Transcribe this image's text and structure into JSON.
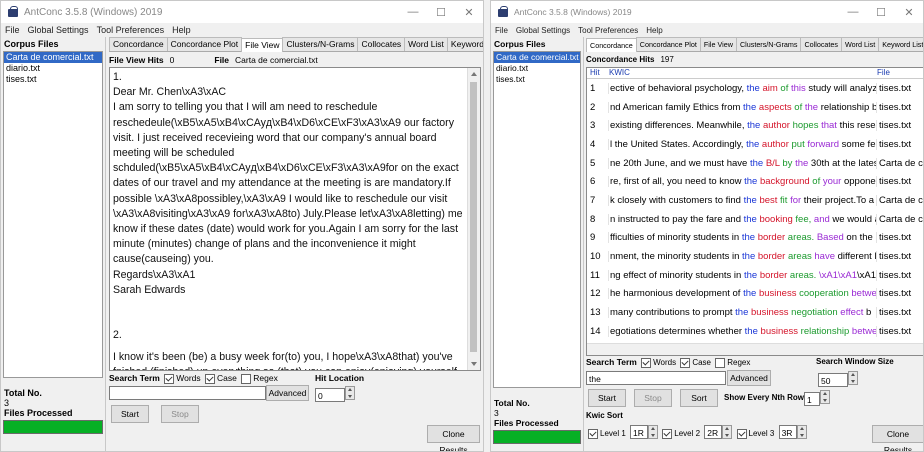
{
  "left_window": {
    "title": "AntConc 3.5.8 (Windows) 2019",
    "menu": [
      "File",
      "Global Settings",
      "Tool Preferences",
      "Help"
    ],
    "corpus_files_label": "Corpus Files",
    "files": [
      "Carta de comercial.txt",
      "diario.txt",
      "tises.txt"
    ],
    "total_no_label": "Total No.",
    "total_no": "3",
    "files_processed_label": "Files Processed",
    "tabs": [
      "Concordance",
      "Concordance Plot",
      "File View",
      "Clusters/N-Grams",
      "Collocates",
      "Word List",
      "Keyword List"
    ],
    "active_tab": "File View",
    "hits_label": "File View Hits",
    "hits_value": "0",
    "file_label": "File",
    "file_value": "Carta de comercial.txt",
    "text_lines": [
      "1.",
      "Dear Mr. Chen\\xA3\\xAC",
      "I am sorry to telling you that I will am need to reschedule reschedeule(\\xB5\\xA5\\xB4\\xCAyд\\xB4\\xD6\\xCE\\xF3\\xA3\\xA9 our factory visit. I just received receviei­ng word that our company's annual board meeting will be scheduled schduled(\\xB5\\xA5\\xB4\\xCAyд\\xB4\\xD6\\xCE\\xF3\\xA3\\xA9for on the exact dates of our travel and my attendance at the meeting is are mandatory.If possible \\xA3\\xA8possibley,\\xA3\\xA9 I would like to reschedule our visit \\xA3\\xA8visiting\\xA3\\xA9 for\\xA3\\xA8to) July.Please let\\xA3\\xA8letting) me know if these dates (date) would work for you.Again I am sorry for the last minute (minutes) change of plans and the inconvenience it might cause(causeing) you.",
      "Regards\\xA3\\xA1",
      "Sarah Edwards",
      "2.",
      "I know it's been (be) a busy week for(to) you, I hope\\xA3\\xA8that) you've fnished (finished) up everything so (that) you can enjoy(enjoying) yourself this weekend.The"
    ],
    "search_term_label": "Search Term",
    "words_label": "Words",
    "case_label": "Case",
    "regex_label": "Regex",
    "hit_location_label": "Hit Location",
    "hit_location_value": "0",
    "advanced_label": "Advanced",
    "start_label": "Start",
    "stop_label": "Stop",
    "clone_label": "Clone Results"
  },
  "right_window": {
    "title": "AntConc 3.5.8 (Windows) 2019",
    "menu": [
      "File",
      "Global Settings",
      "Tool Preferences",
      "Help"
    ],
    "corpus_files_label": "Corpus Files",
    "files": [
      "Carta de comercial.txt",
      "diario.txt",
      "tises.txt"
    ],
    "total_no_label": "Total No.",
    "total_no": "3",
    "files_processed_label": "Files Processed",
    "tabs": [
      "Concordance",
      "Concordance Plot",
      "File View",
      "Clusters/N-Grams",
      "Collocates",
      "Word List",
      "Keyword List"
    ],
    "active_tab": "Concordance",
    "hits_label": "Concordance Hits",
    "hits_value": "197",
    "col_hit": "Hit",
    "col_kwic": "KWIC",
    "col_file": "File",
    "rows": [
      {
        "hit": "1",
        "left": "ective of behavioral psychology, ",
        "kw": "the",
        "r1": "aim",
        "r2": "of",
        "r3": "this",
        "rest": " study will analyze",
        "file": "tises.txt"
      },
      {
        "hit": "2",
        "left": "nd American family Ethics from ",
        "kw": "the",
        "r1": "aspects",
        "r2": "of",
        "r3": "the",
        "rest": " relationship b",
        "file": "tises.txt"
      },
      {
        "hit": "3",
        "left": "existing differences. Meanwhile, ",
        "kw": "the",
        "r1": "author",
        "r2": "hopes",
        "r3": "that",
        "rest": " this resea",
        "file": "tises.txt"
      },
      {
        "hit": "4",
        "left": "l the United States. Accordingly, ",
        "kw": "the",
        "r1": "author",
        "r2": "put",
        "r3": "forward",
        "rest": " some fe",
        "file": "tises.txt"
      },
      {
        "hit": "5",
        "left": "ne 20th June, and we must have ",
        "kw": "the",
        "r1": "B/L",
        "r2": "by",
        "r3": "the",
        "rest": " 30th at the latest.",
        "file": "Carta de con"
      },
      {
        "hit": "6",
        "left": "re, first of all, you need to know ",
        "kw": "the",
        "r1": "background",
        "r2": "of",
        "r3": "your",
        "rest": " oppone",
        "file": "tises.txt"
      },
      {
        "hit": "7",
        "left": "k closely with customers to find ",
        "kw": "the",
        "r1": "best",
        "r2": "fit",
        "r3": "for",
        "rest": " their project.To a",
        "file": "Carta de con"
      },
      {
        "hit": "8",
        "left": "n instructed to pay the fare and ",
        "kw": "the",
        "r1": "booking",
        "r2": "fee,",
        "r3": "and",
        "rest": " we would a",
        "file": "Carta de con"
      },
      {
        "hit": "9",
        "left": "fficulties of minority students in ",
        "kw": "the",
        "r1": "border",
        "r2": "areas.",
        "r3": "Based",
        "rest": " on the S",
        "file": "tises.txt"
      },
      {
        "hit": "10",
        "left": "nment, the minority students in ",
        "kw": "the",
        "r1": "border",
        "r2": "areas",
        "r3": "have",
        "rest": " different l",
        "file": "tises.txt"
      },
      {
        "hit": "11",
        "left": "ng effect of minority students in ",
        "kw": "the",
        "r1": "border",
        "r2": "areas.",
        "r3": "\\xA1\\xA1",
        "rest": "\\xA1",
        "file": "tises.txt"
      },
      {
        "hit": "12",
        "left": "he harmonious development of ",
        "kw": "the",
        "r1": "business",
        "r2": "cooperation",
        "r3": "betwe",
        "rest": "",
        "file": "tises.txt"
      },
      {
        "hit": "13",
        "left": "many contributions to prompt ",
        "kw": "the",
        "r1": "business",
        "r2": "negotiation",
        "r3": "effect",
        "rest": " b",
        "file": "tises.txt"
      },
      {
        "hit": "14",
        "left": "egotiations determines whether ",
        "kw": "the",
        "r1": "business",
        "r2": "relationship",
        "r3": "betwe",
        "rest": "",
        "file": "tises.txt"
      }
    ],
    "search_term_label": "Search Term",
    "words_label": "Words",
    "case_label": "Case",
    "regex_label": "Regex",
    "search_window_label": "Search Window Size",
    "search_window_value": "50",
    "search_value": "the",
    "advanced_label": "Advanced",
    "start_label": "Start",
    "stop_label": "Stop",
    "sort_label": "Sort",
    "nth_label": "Show Every Nth Row",
    "nth_value": "1",
    "kwic_sort_label": "Kwic Sort",
    "level1_label": "Level 1",
    "level1_value": "1R",
    "level2_label": "Level 2",
    "level2_value": "2R",
    "level3_label": "Level 3",
    "level3_value": "3R",
    "clone_label": "Clone Results"
  }
}
